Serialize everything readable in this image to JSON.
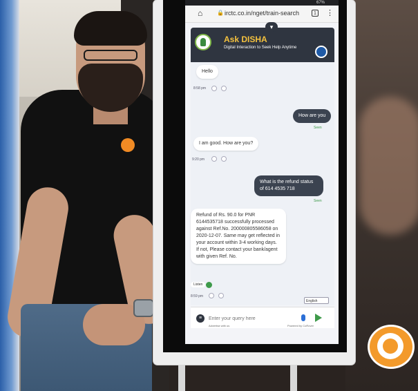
{
  "browser": {
    "url": "irctc.co.in/nget/train-search",
    "battery": "67%"
  },
  "chat": {
    "title": "Ask DISHA",
    "subtitle": "Digital Interaction to Seek Help Anytime",
    "messages": [
      {
        "from": "bot",
        "text": "Hello",
        "time": "8:58 pm"
      },
      {
        "from": "user",
        "text": "How are you",
        "status": "Seen"
      },
      {
        "from": "bot",
        "text": "I am good. How are you?",
        "time": "9:20 pm"
      },
      {
        "from": "user",
        "text": "What is the refund status of 614 4535 718",
        "status": "Seen"
      },
      {
        "from": "bot",
        "text": "Refund of Rs. 90.0 for PNR 6144535718 successfully processed against Ref.No. 200000805586058 on 2020-12-07. Same may get reflected in your account within 3-4 working days. If not, Please contact your bank/agent with given Ref. No.",
        "time": "8:59 pm",
        "listen": "Listen"
      }
    ],
    "language": "English",
    "input_placeholder": "Enter your query here",
    "footer_left": "Advertise with us",
    "footer_right": "Powered by CoRover"
  },
  "icons": {
    "home": "home-icon",
    "lock": "lock-icon",
    "tabs": "tabs-icon",
    "menu": "more-vert-icon",
    "collapse": "chevron-down-icon",
    "thumbs_up": "thumbs-up-icon",
    "thumbs_down": "thumbs-down-icon",
    "mic": "mic-icon",
    "send": "send-icon"
  },
  "colors": {
    "header_bg": "#2f3540",
    "title_yellow": "#f5c23e",
    "user_bubble": "#3b4350",
    "bot_bubble": "#ffffff",
    "watermark": "#f39a2b"
  }
}
